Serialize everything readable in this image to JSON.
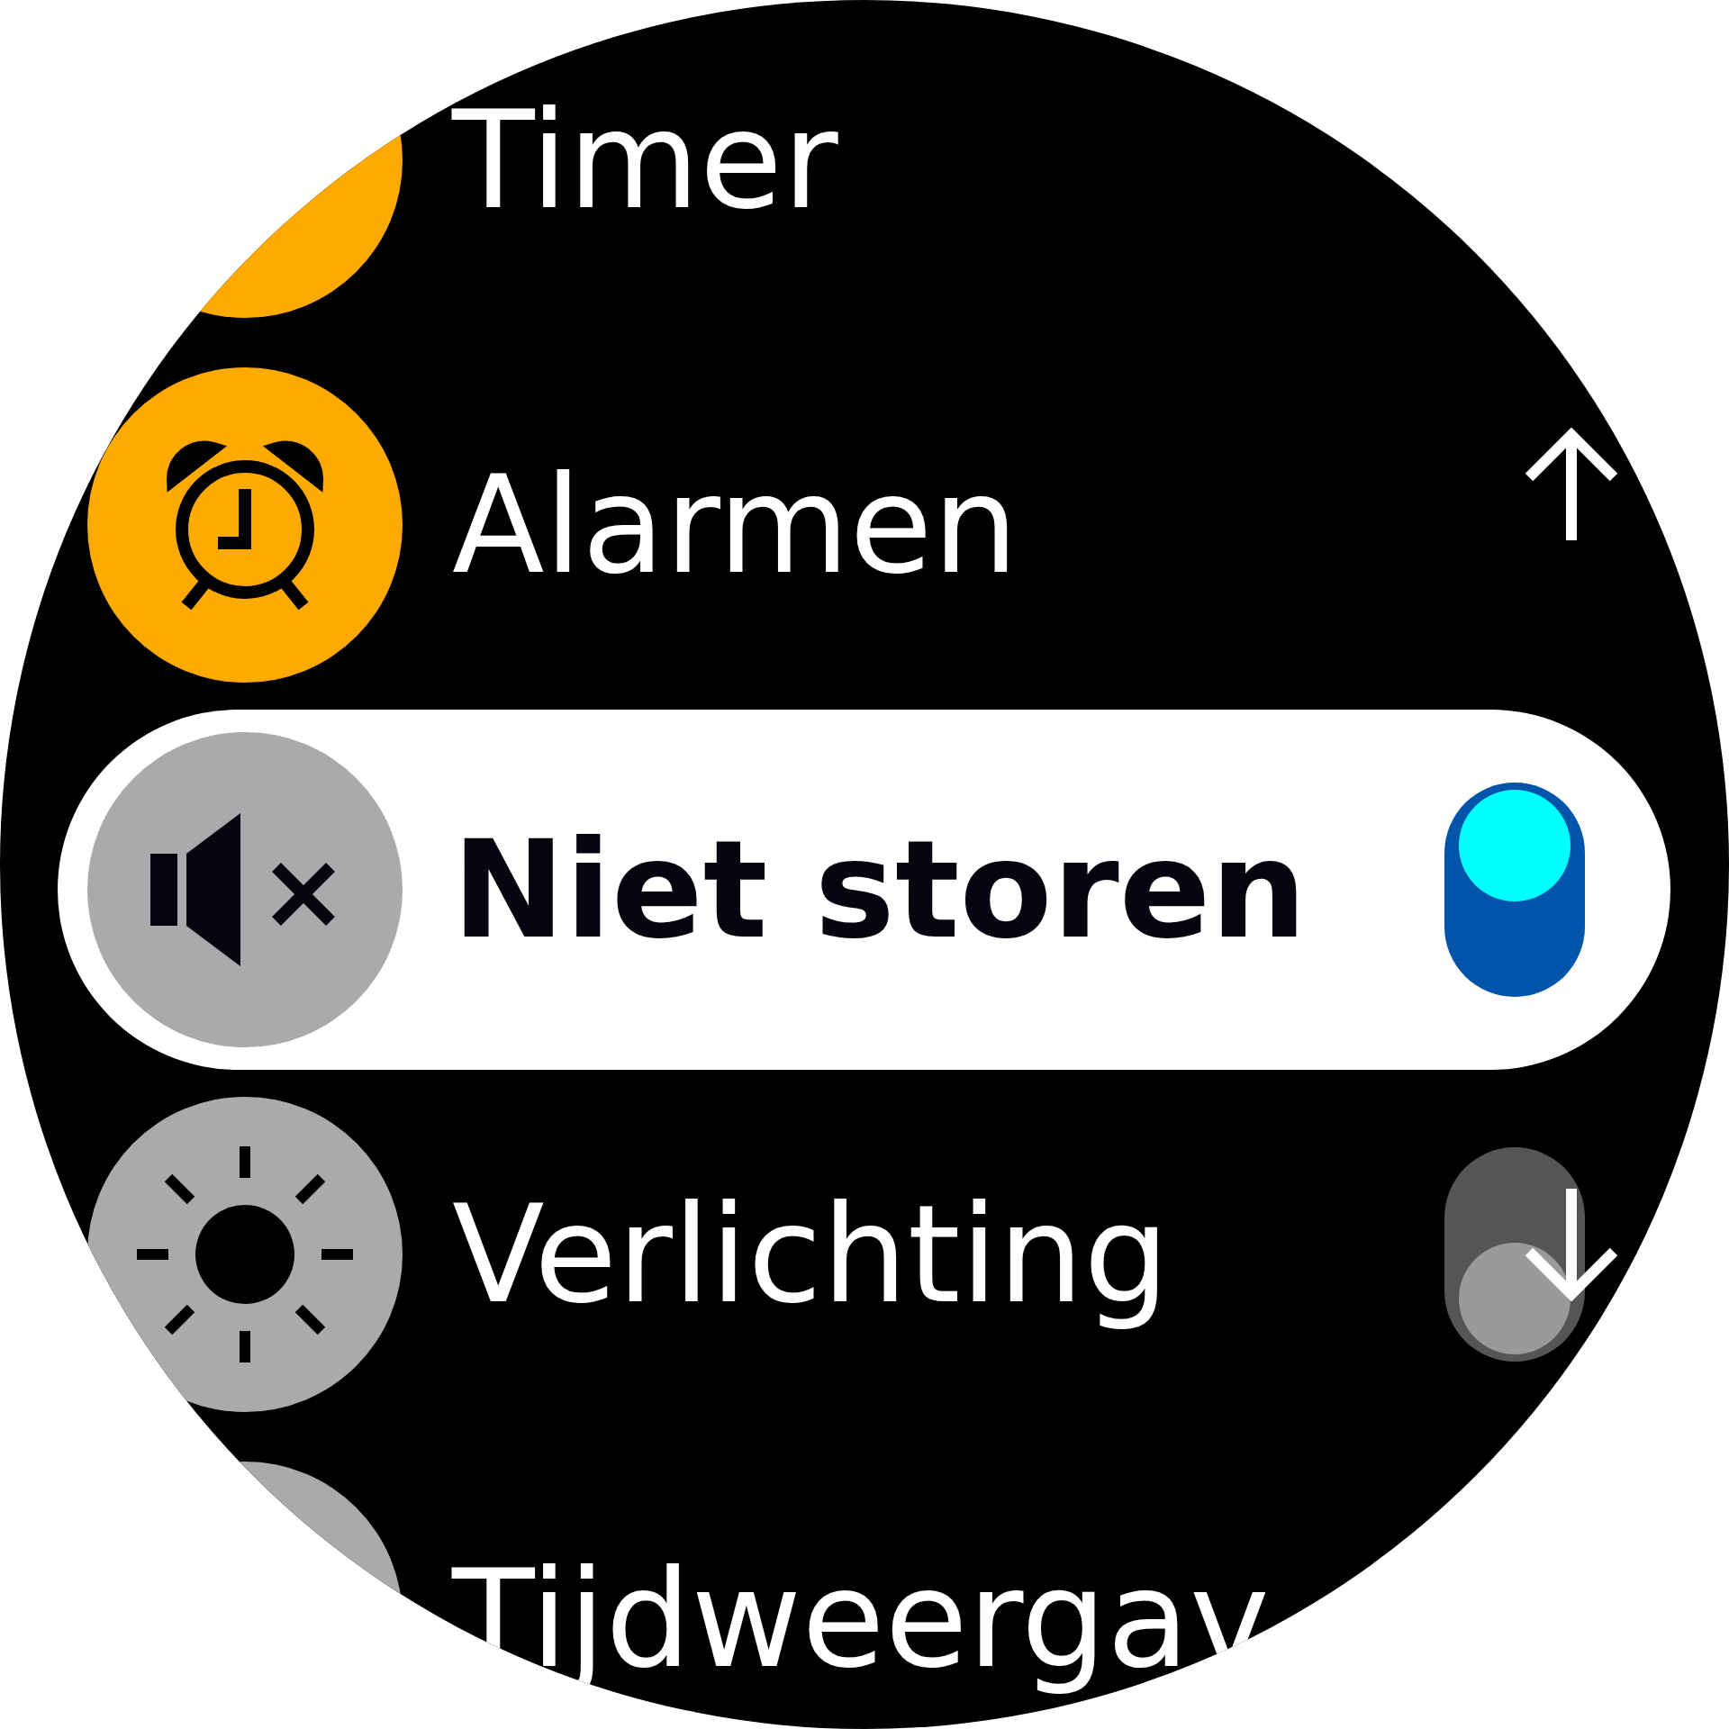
{
  "items": [
    {
      "label": "Timer",
      "kind": "timer",
      "color": "#ffaa00",
      "selected": false
    },
    {
      "label": "Alarmen",
      "kind": "alarm",
      "color": "#ffaa00",
      "selected": false
    },
    {
      "label": "Niet storen",
      "kind": "mute",
      "color": "#aaaaac",
      "selected": true,
      "toggle": {
        "on": true
      }
    },
    {
      "label": "Verlichting",
      "kind": "sun",
      "color": "#aaaaac",
      "selected": false,
      "toggle": {
        "on": false
      }
    },
    {
      "label": "Tijdweergav",
      "kind": "blank",
      "color": "#aaaaac",
      "selected": false
    }
  ]
}
